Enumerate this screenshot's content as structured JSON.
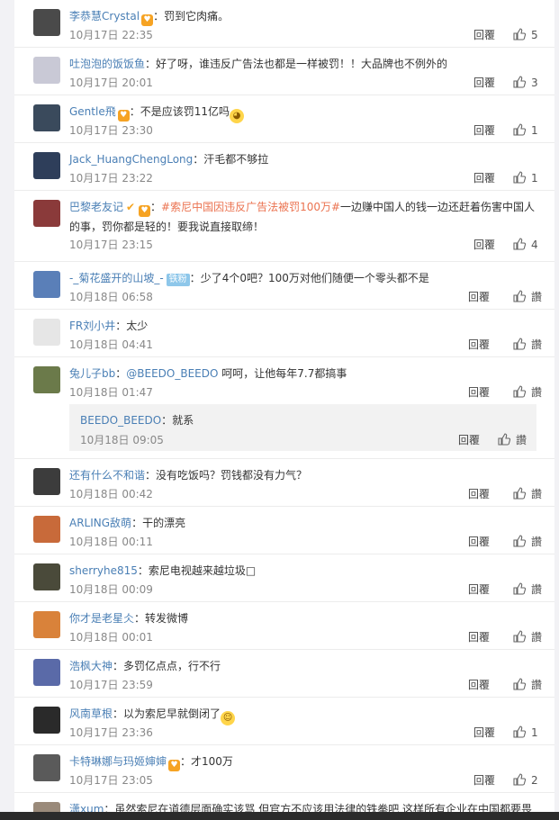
{
  "ui": {
    "reply_label": "回覆",
    "like_label": "讚",
    "colon": "："
  },
  "comments": [
    {
      "user": "李恭慧Crystal",
      "badge": true,
      "text": "罚到它肉痛。",
      "time": "10月17日 22:35",
      "likes": "5",
      "avatar_color": "#4a4a4a"
    },
    {
      "user": "吐泡泡的饭饭鱼",
      "text": "好了呀，谁违反广告法也都是一样被罚！！大品牌也不例外的",
      "time": "10月17日 20:01",
      "likes": "3",
      "avatar_color": "#c9c9d6"
    },
    {
      "user": "Gentle飛",
      "badge": true,
      "text": "不是应该罚11亿吗",
      "emoji": "doge",
      "time": "10月17日 23:30",
      "likes": "1",
      "avatar_color": "#3a4a5c"
    },
    {
      "user": "Jack_HuangChengLong",
      "text": "汗毛都不够拉",
      "time": "10月17日 23:22",
      "likes": "1",
      "avatar_color": "#2e3e5a"
    },
    {
      "user": "巴黎老友记",
      "vip": true,
      "badge": true,
      "text_link": "#索尼中国因违反广告法被罚100万#",
      "text": "一边赚中国人的钱一边还赶着伤害中国人",
      "text2": "的事，罚你都是轻的！要我说直接取缔！",
      "time": "10月17日 23:15",
      "likes": "4",
      "avatar_color": "#8a3a3a"
    },
    {
      "user": "-_菊花盛开的山坡_-",
      "fan_label": "铁粉",
      "text": "少了4个0吧？100万对他们随便一个零头都不是",
      "time": "10月18日 06:58",
      "avatar_color": "#5a7fb8"
    },
    {
      "user": "FR刘小井",
      "text": "太少",
      "time": "10月18日 04:41",
      "avatar_color": "#e6e6e6"
    },
    {
      "user": "兔儿子bb",
      "text_link": "@BEEDO_BEEDO",
      "text": " 呵呵，让他每年7.7都搞事",
      "time": "10月18日 01:47",
      "avatar_color": "#6b7a4a"
    },
    {
      "user": "还有什么不和谐",
      "text": "没有吃饭吗？罚钱都没有力气？",
      "time": "10月18日 00:42",
      "avatar_color": "#3c3c3c"
    },
    {
      "user": "ARLING敌萌",
      "text": "干的漂亮",
      "time": "10月18日 00:11",
      "avatar_color": "#c86a3a"
    },
    {
      "user": "sherryhe815",
      "text": "索尼电视越来越垃圾□",
      "time": "10月18日 00:09",
      "avatar_color": "#4a4a3a"
    },
    {
      "user": "你才是老星仌",
      "text": "转发微博",
      "time": "10月18日 00:01",
      "avatar_color": "#d9823a"
    },
    {
      "user": "浩枫大神",
      "text": "多罚亿点点，行不行",
      "time": "10月17日 23:59",
      "avatar_color": "#5a6aa8"
    },
    {
      "user": "风南草根",
      "text": "以为索尼早就倒闭了",
      "emoji": "laugh",
      "time": "10月17日 23:36",
      "likes": "1",
      "avatar_color": "#2a2a2a"
    },
    {
      "user": "卡特琳娜与玛姬婶婶",
      "badge": true,
      "text": "才100万",
      "time": "10月17日 23:05",
      "likes": "2",
      "avatar_color": "#5a5a5a"
    },
    {
      "user": "潇xum",
      "text": "虽然索尼在道德层面确实该骂 但官方不应该用法律的铁拳吧 这样所有企业在中国都要畏",
      "time": "",
      "avatar_color": "#9a8a7a"
    }
  ],
  "subreply": {
    "user": "BEEDO_BEEDO",
    "text": "就系",
    "time": "10月18日 09:05"
  },
  "colors": {
    "link": "#eb7350",
    "username": "#4a7fb5",
    "meta": "#888888"
  }
}
